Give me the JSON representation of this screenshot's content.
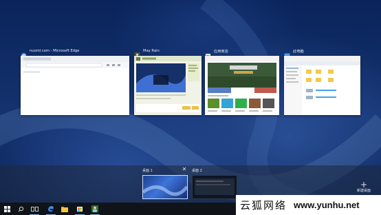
{
  "windows": [
    {
      "title": "nuomi.com - Microsoft Edge",
      "icon": "edge-icon"
    },
    {
      "title": "May Rain",
      "icon": "app-avatar-icon"
    },
    {
      "title": "应用商店",
      "icon": "store-icon"
    },
    {
      "title": "此电脑",
      "icon": "this-pc-icon"
    }
  ],
  "desktops": [
    {
      "label": "桌面 1"
    },
    {
      "label": "桌面 2"
    }
  ],
  "new_desktop": {
    "plus": "+",
    "label": "新建桌面"
  },
  "close_glyph": "✕",
  "watermark": {
    "text_cn": "云狐网络",
    "url": "www.yunhu.net"
  },
  "colors": {
    "accent": "#2b6fd6",
    "taskbar": "#101418"
  }
}
